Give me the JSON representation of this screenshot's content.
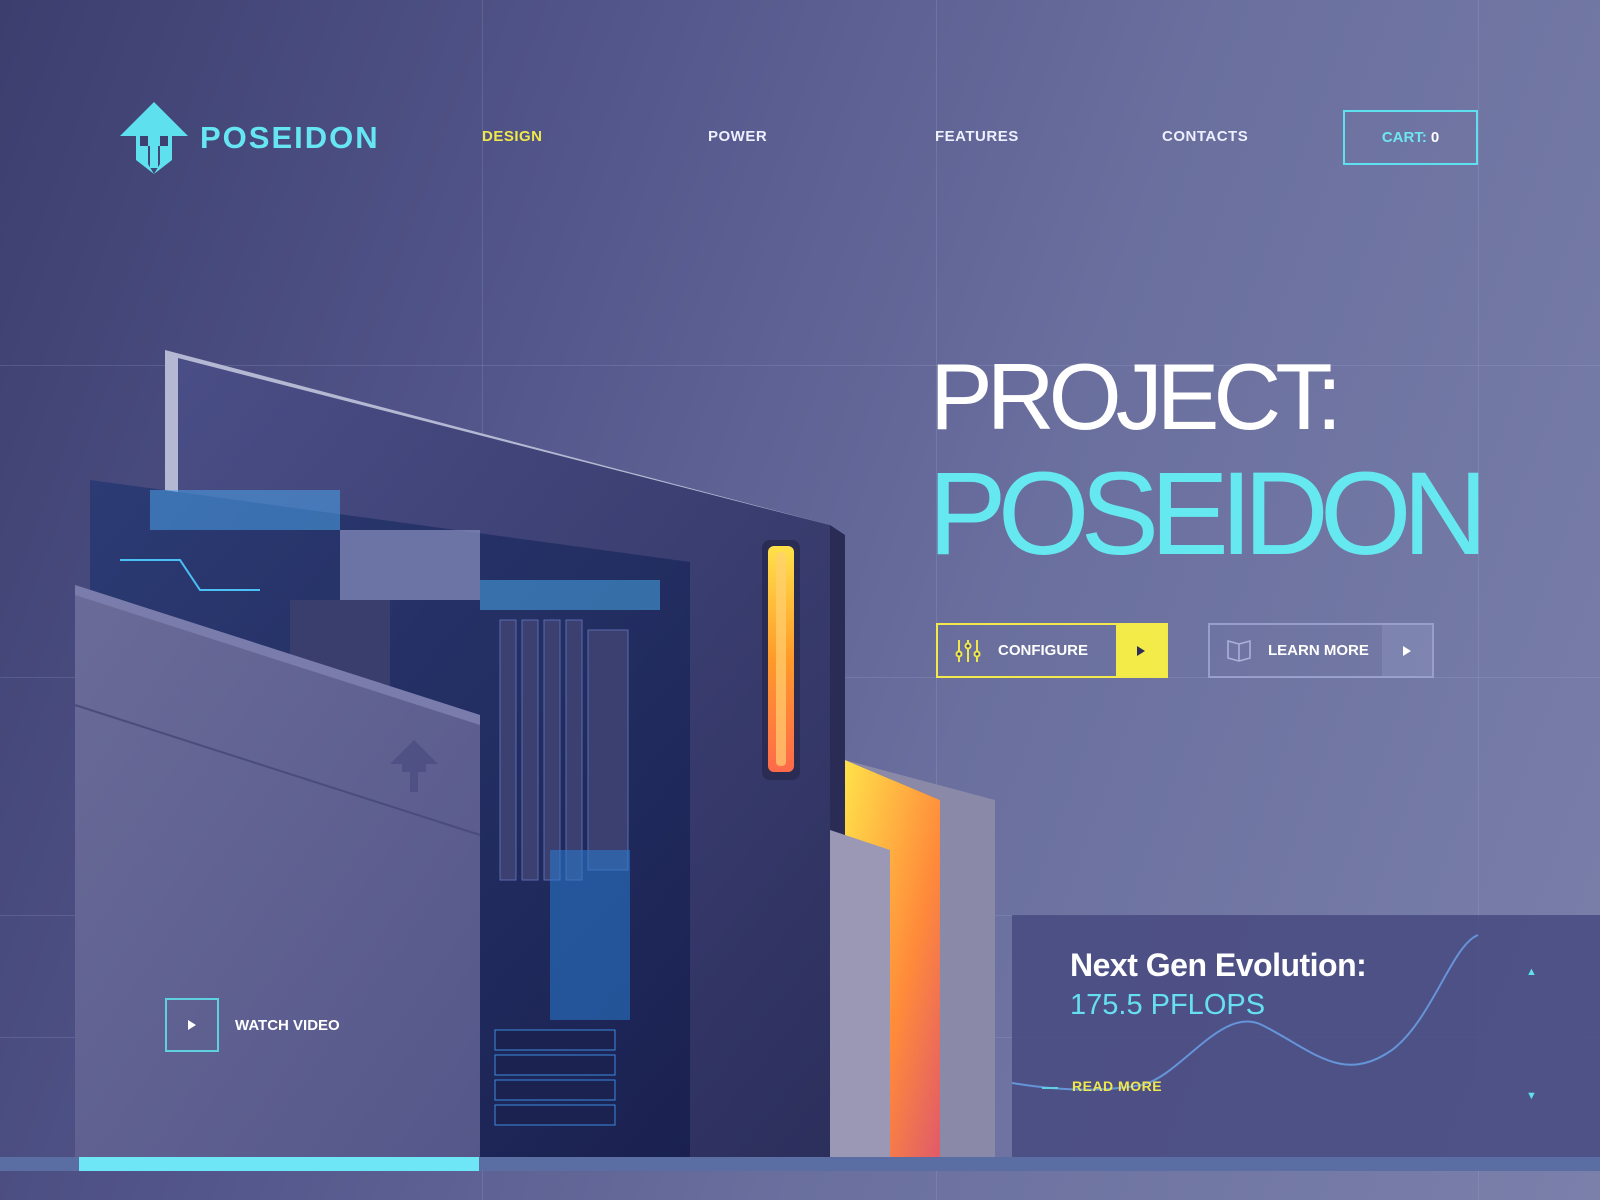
{
  "brand": {
    "name": "POSEIDON",
    "color": "#66e6f2"
  },
  "nav": {
    "items": [
      {
        "label": "DESIGN",
        "active": true
      },
      {
        "label": "POWER",
        "active": false
      },
      {
        "label": "FEATURES",
        "active": false
      },
      {
        "label": "CONTACTS",
        "active": false
      }
    ],
    "cart_label": "CART:",
    "cart_count": "0"
  },
  "hero": {
    "line1": "PROJECT:",
    "line2": "POSEIDON"
  },
  "buttons": {
    "configure": {
      "label": "CONFIGURE",
      "icon": "sliders-icon",
      "arrow": "play-arrow-icon"
    },
    "learn_more": {
      "label": "LEARN MORE",
      "icon": "book-icon",
      "arrow": "play-arrow-icon"
    }
  },
  "video": {
    "label": "WATCH VIDEO",
    "icon": "play-icon"
  },
  "panel": {
    "title": "Next Gen Evolution:",
    "value": "175.5 PFLOPS",
    "link": "READ MORE",
    "prev_icon": "arrow-up-icon",
    "next_icon": "arrow-down-icon"
  },
  "slider": {
    "progress": 0.25
  },
  "colors": {
    "accent_cyan": "#66e6f2",
    "accent_yellow": "#f3eb48",
    "background": "#55598c"
  }
}
